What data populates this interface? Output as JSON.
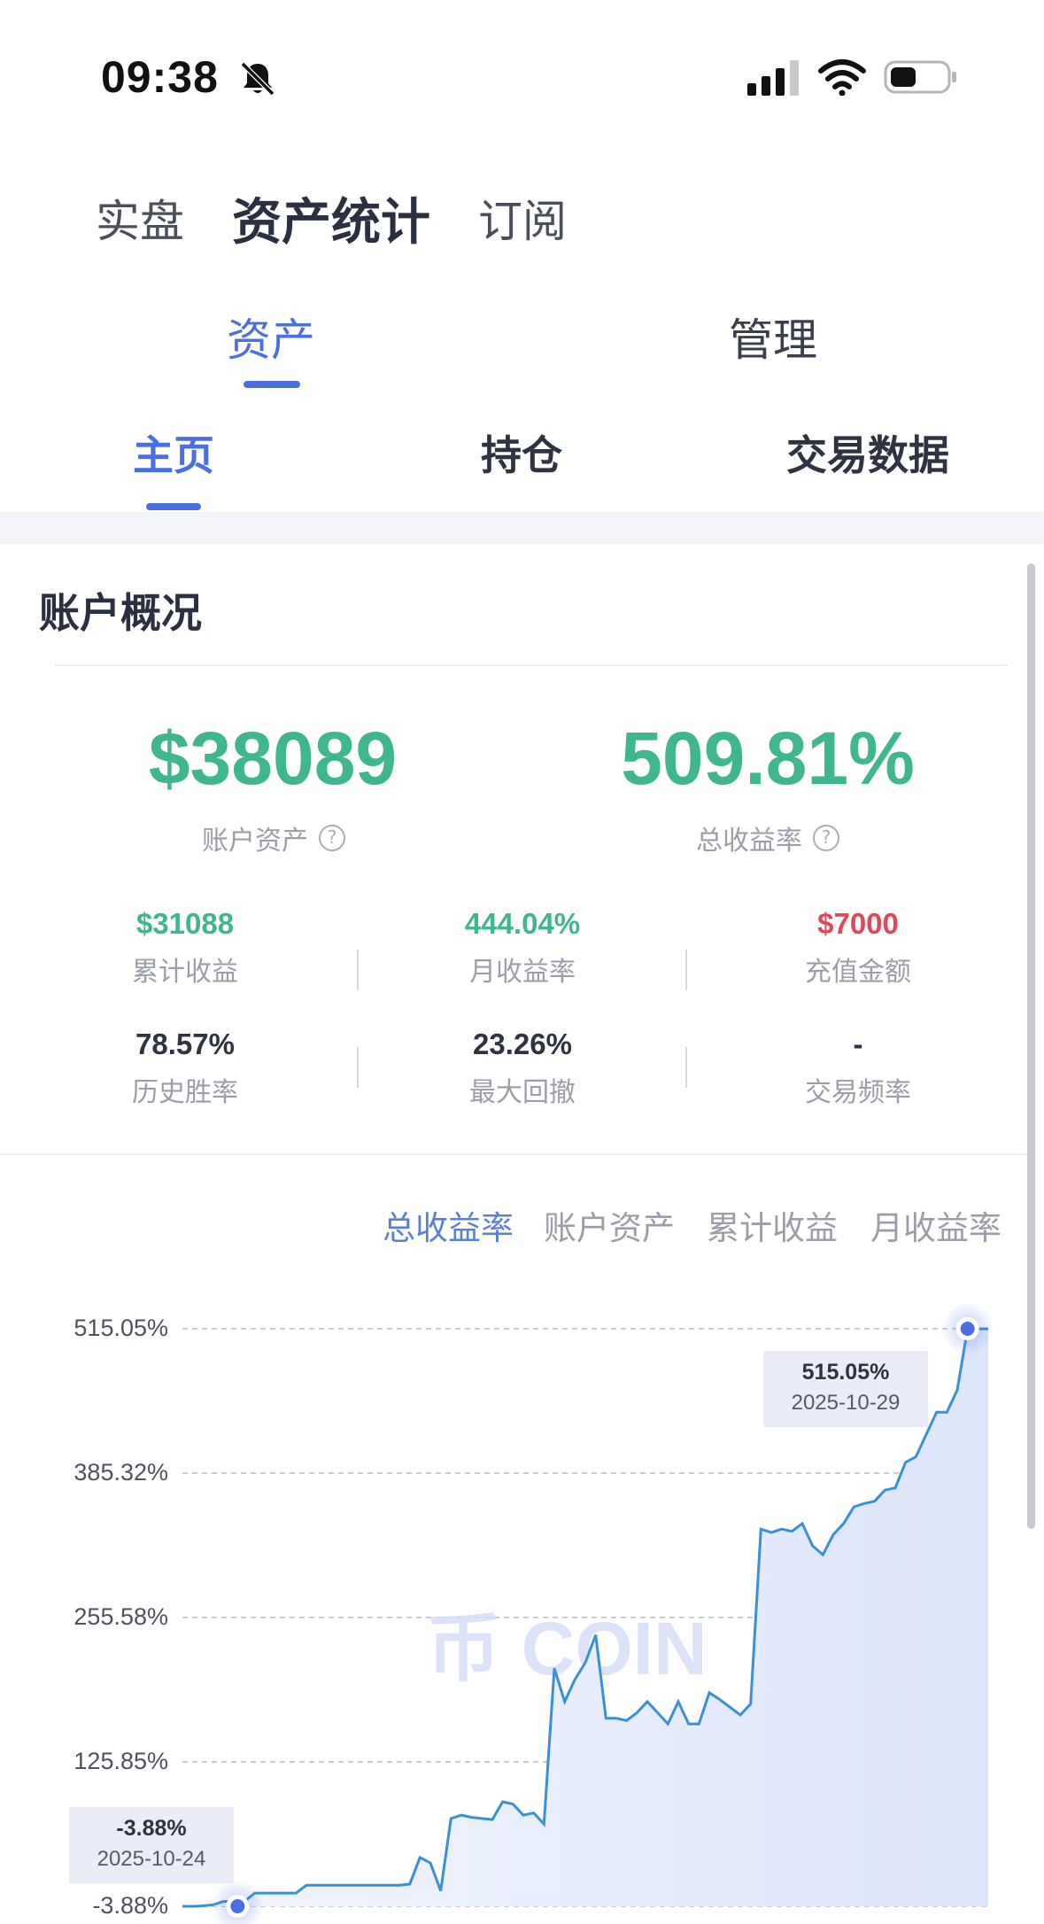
{
  "status_bar": {
    "time": "09:38"
  },
  "top_tabs": [
    {
      "label": "实盘"
    },
    {
      "label": "资产统计"
    },
    {
      "label": "订阅"
    }
  ],
  "sub_tabs": [
    {
      "label": "资产"
    },
    {
      "label": "管理"
    }
  ],
  "page_tabs": [
    {
      "label": "主页"
    },
    {
      "label": "持仓"
    },
    {
      "label": "交易数据"
    }
  ],
  "overview": {
    "title": "账户概况",
    "account_assets": {
      "value": "$38089",
      "label": "账户资产"
    },
    "total_return": {
      "value": "509.81%",
      "label": "总收益率"
    },
    "stats": [
      {
        "value": "$31088",
        "label": "累计收益",
        "color": "#3fb68b"
      },
      {
        "value": "444.04%",
        "label": "月收益率",
        "color": "#3fb68b"
      },
      {
        "value": "$7000",
        "label": "充值金额",
        "color": "#e04858"
      },
      {
        "value": "78.57%",
        "label": "历史胜率",
        "color": "#2e3342"
      },
      {
        "value": "23.26%",
        "label": "最大回撤",
        "color": "#2e3342"
      },
      {
        "value": "-",
        "label": "交易频率",
        "color": "#2e3342"
      }
    ]
  },
  "chart_tabs": [
    {
      "label": "总收益率",
      "active": true
    },
    {
      "label": "账户资产",
      "active": false
    },
    {
      "label": "累计收益",
      "active": false
    },
    {
      "label": "月收益率",
      "active": false
    }
  ],
  "chart_data": {
    "type": "area",
    "title": "",
    "xlabel": "",
    "ylabel": "",
    "y_ticks": [
      "515.05%",
      "385.32%",
      "255.58%",
      "125.85%",
      "-3.88%"
    ],
    "ylim": [
      -3.88,
      515.05
    ],
    "x_range": [
      "2025-10-24",
      "2025-10-29"
    ],
    "series": [
      {
        "values": [
          -3.9,
          -3.9,
          -3.5,
          -2.5,
          0.5,
          0.5,
          0.5,
          8,
          8,
          8,
          8,
          8,
          15,
          15,
          15,
          15,
          15,
          15,
          15,
          15,
          15,
          15,
          16,
          40,
          35,
          10,
          75,
          78,
          76,
          75,
          74,
          90,
          88,
          78,
          80,
          70,
          210,
          180,
          200,
          215,
          240,
          165,
          165,
          163,
          170,
          180,
          170,
          160,
          180,
          160,
          160,
          188,
          182,
          175,
          168,
          178,
          335,
          332,
          335,
          333,
          340,
          320,
          312,
          330,
          340,
          355,
          358,
          360,
          370,
          372,
          395,
          400,
          420,
          440,
          440,
          460,
          515,
          515,
          515
        ]
      }
    ],
    "markers": [
      {
        "value": "-3.88%",
        "date": "2025-10-24"
      },
      {
        "value": "515.05%",
        "date": "2025-10-29"
      }
    ],
    "grid": true,
    "watermark": "COIN",
    "line_color": "#3a8fd6",
    "fill_color": "#e3e9fb"
  }
}
